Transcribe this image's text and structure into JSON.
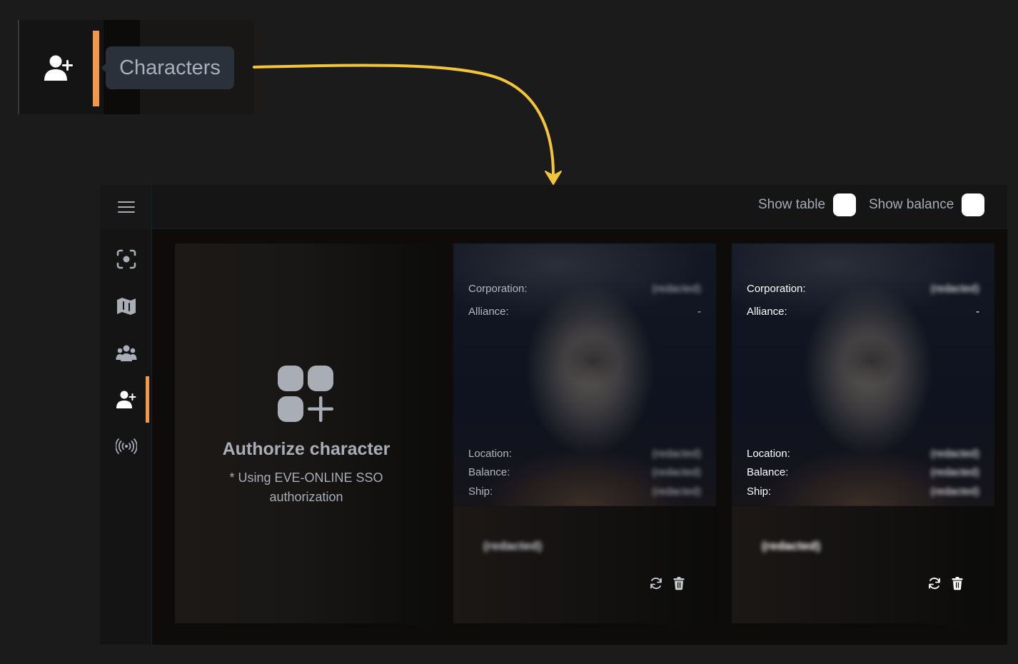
{
  "callout": {
    "icon": "user-plus-icon",
    "tooltip": "Characters",
    "accent_color": "#f0994a"
  },
  "annotation": {
    "arrow_color": "#f2c53d"
  },
  "sidebar": {
    "menu_icon": "hamburger-menu-icon",
    "items": [
      {
        "icon": "scan-target-icon",
        "label": "Scan"
      },
      {
        "icon": "map-icon",
        "label": "Map"
      },
      {
        "icon": "users-group-icon",
        "label": "Group"
      },
      {
        "icon": "user-plus-icon",
        "label": "Characters",
        "active": true
      },
      {
        "icon": "broadcast-icon",
        "label": "Broadcast"
      }
    ],
    "active_color": "#f0994a"
  },
  "topbar": {
    "show_table_label": "Show table",
    "show_table_checked": false,
    "show_balance_label": "Show balance",
    "show_balance_checked": false
  },
  "authorize_card": {
    "icon": "apps-add-icon",
    "title": "Authorize character",
    "subtitle": "* Using EVE-ONLINE SSO authorization"
  },
  "characters": [
    {
      "labels": {
        "corporation": "Corporation:",
        "alliance": "Alliance:",
        "location": "Location:",
        "balance": "Balance:",
        "ship": "Ship:"
      },
      "corporation": "(redacted)",
      "alliance": "-",
      "location": "(redacted)",
      "balance": "(redacted)",
      "ship": "(redacted)",
      "name": "(redacted)",
      "refresh_icon": "refresh-icon",
      "delete_icon": "trash-icon"
    },
    {
      "labels": {
        "corporation": "Corporation:",
        "alliance": "Alliance:",
        "location": "Location:",
        "balance": "Balance:",
        "ship": "Ship:"
      },
      "corporation": "(redacted)",
      "alliance": "-",
      "location": "(redacted)",
      "balance": "(redacted)",
      "ship": "(redacted)",
      "name": "(redacted)",
      "refresh_icon": "refresh-icon",
      "delete_icon": "trash-icon"
    }
  ]
}
